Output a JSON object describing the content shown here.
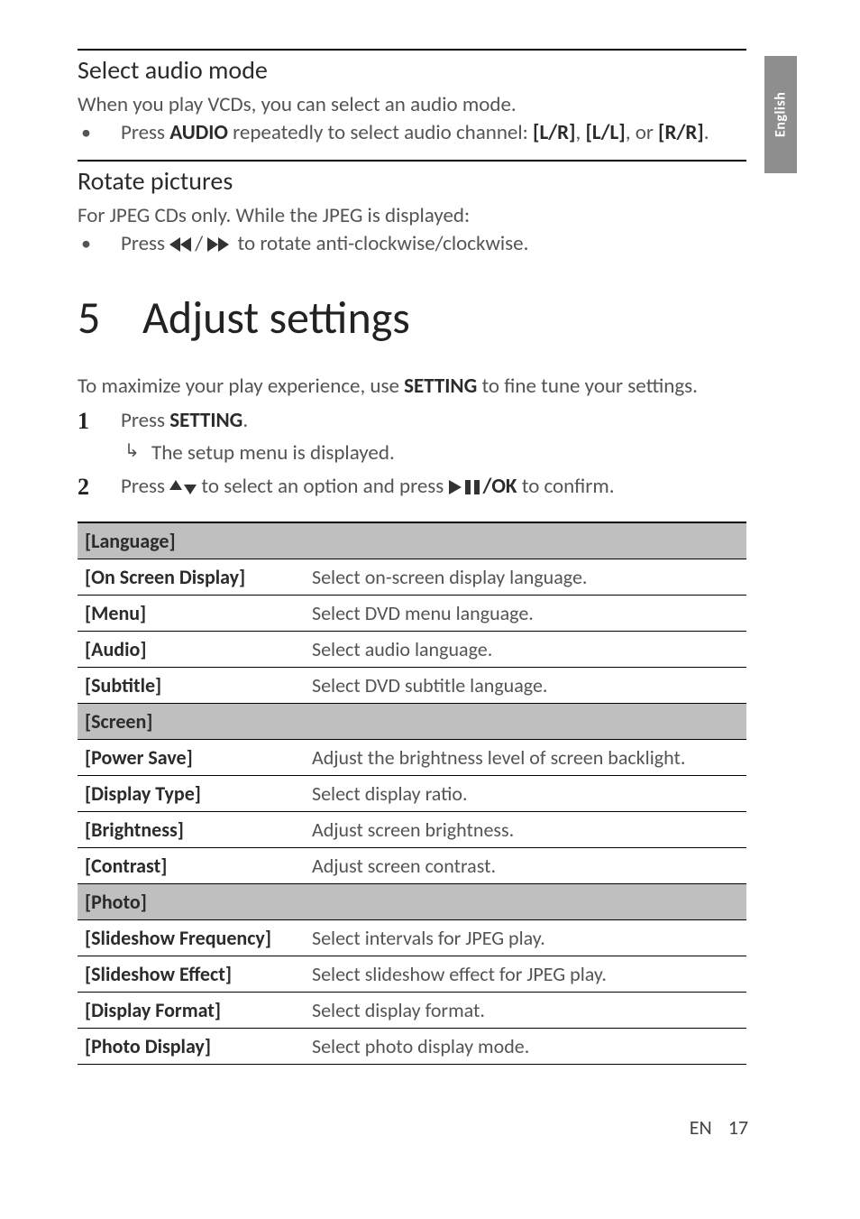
{
  "sideTab": "English",
  "section1": {
    "heading": "Select audio mode",
    "intro": "When you play VCDs, you can select an audio mode.",
    "bullet_pre": "Press ",
    "bullet_key": "AUDIO",
    "bullet_post": " repeatedly to select audio channel: ",
    "opt1": "[L/R]",
    "opt_sep1": ", ",
    "opt2": "[L/L]",
    "opt_sep2": ", or ",
    "opt3": "[R/R]",
    "opt_end": "."
  },
  "section2": {
    "heading": "Rotate pictures",
    "intro": "For JPEG CDs only. While the JPEG is displayed:",
    "bullet_pre": "Press ",
    "bullet_sep": "/",
    "bullet_post": " to rotate anti-clockwise/clockwise."
  },
  "chapter": {
    "num": "5",
    "title": "Adjust settings",
    "intro_pre": "To maximize your play experience, use ",
    "intro_key": "SETTING",
    "intro_post": " to fine tune your settings.",
    "step1_pre": "Press ",
    "step1_key": "SETTING",
    "step1_post": ".",
    "step1_result": "The setup menu is displayed.",
    "step2_pre": "Press ",
    "step2_mid": " to select an option and press ",
    "step2_ok": "/OK",
    "step2_post": " to confirm."
  },
  "table": {
    "rows": [
      {
        "type": "section",
        "label": "[Language]"
      },
      {
        "type": "row",
        "label": "[On Screen Display]",
        "desc": "Select on-screen display language."
      },
      {
        "type": "row",
        "label": "[Menu]",
        "desc": "Select DVD menu language."
      },
      {
        "type": "row",
        "label": "[Audio]",
        "desc": "Select audio language."
      },
      {
        "type": "row",
        "label": "[Subtitle]",
        "desc": "Select DVD subtitle language."
      },
      {
        "type": "section",
        "label": "[Screen]"
      },
      {
        "type": "row",
        "label": "[Power Save]",
        "desc": "Adjust the brightness level of screen backlight."
      },
      {
        "type": "row",
        "label": "[Display Type]",
        "desc": "Select display ratio."
      },
      {
        "type": "row",
        "label": "[Brightness]",
        "desc": "Adjust screen brightness."
      },
      {
        "type": "row",
        "label": "[Contrast]",
        "desc": "Adjust screen contrast."
      },
      {
        "type": "section",
        "label": "[Photo]"
      },
      {
        "type": "row",
        "label": "[Slideshow Frequency]",
        "desc": "Select intervals for JPEG play."
      },
      {
        "type": "row",
        "label": "[Slideshow Effect]",
        "desc": "Select slideshow effect for JPEG play."
      },
      {
        "type": "row",
        "label": "[Display Format]",
        "desc": "Select display format."
      },
      {
        "type": "row",
        "label": "[Photo Display]",
        "desc": "Select photo display mode."
      }
    ]
  },
  "footer": {
    "lang": "EN",
    "page": "17"
  }
}
